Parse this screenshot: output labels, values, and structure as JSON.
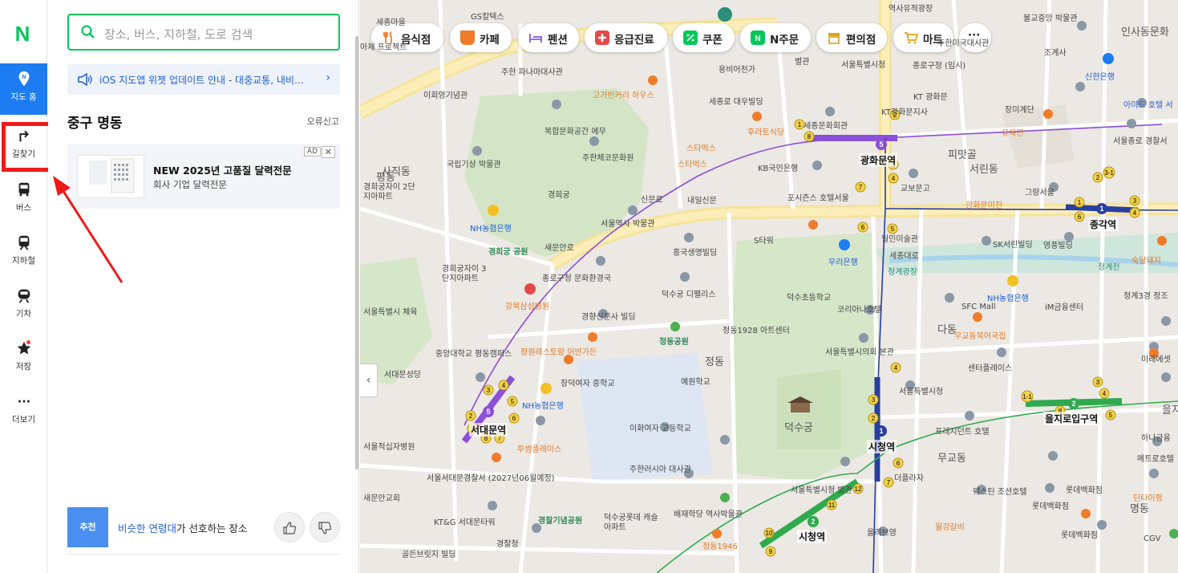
{
  "rail": {
    "logo": "N",
    "items": [
      {
        "label": "지도 홈"
      },
      {
        "label": "길찾기"
      },
      {
        "label": "버스"
      },
      {
        "label": "지하철"
      },
      {
        "label": "기차"
      },
      {
        "label": "저장"
      },
      {
        "label": "더보기"
      }
    ]
  },
  "panel": {
    "search_placeholder": "장소, 버스, 지하철, 도로 검색",
    "notice": "iOS 지도앱 위젯 업데이트 안내 - 대중교통, 내비…",
    "region": "중구 명동",
    "report": "오류신고",
    "ad": {
      "tag": "AD",
      "close": "✕",
      "title": "NEW 2025년 고품질 달력전문",
      "subtitle": "회사 기업 달력전문"
    },
    "recommend": {
      "badge": "추천",
      "highlight": "비슷한 연령대",
      "text": "가 선호하는 장소"
    }
  },
  "map": {
    "categories": [
      {
        "label": "음식점",
        "color": "#f07c2a"
      },
      {
        "label": "카페",
        "color": "#f07c2a"
      },
      {
        "label": "펜션",
        "color": "#8a5ad8"
      },
      {
        "label": "응급진료",
        "color": "#e54848"
      },
      {
        "label": "쿠폰",
        "color": "#03c75a"
      },
      {
        "label": "N주문",
        "color": "#03c75a"
      },
      {
        "label": "편의점",
        "color": "#e2a21b"
      },
      {
        "label": "마트",
        "color": "#e2a21b"
      },
      {
        "label": "···",
        "color": "#444444"
      }
    ],
    "labels": {
      "l01": "주한 파나마대사관",
      "l02": "이회영기념관",
      "l03": "복합문화공간 에무",
      "l04": "주한체코문화원",
      "l05": "국립기상 박물관",
      "l06": "경희궁",
      "l07": "NH농협은행",
      "l08": "서울역사 박물관",
      "l09": "경희궁자이 2단지아파트",
      "l10": "경희궁자이 3단지아파트",
      "l11": "강북삼성병원",
      "l12": "종로구청 문화환경국",
      "l13": "경향신문사 빌딩",
      "l14": "정원레스토랑 어반가든",
      "l15": "중앙대학교 평동캠퍼스",
      "l16": "서대문성당",
      "l17": "창덕여자 중학교",
      "l18": "NH농협은행",
      "l19": "서대문역",
      "l20": "투썸플레이스",
      "l21": "이화여자 고등학교",
      "l22": "주한러시아 대사관",
      "l23": "서울서대문경찰서 (2027년06월예정)",
      "l24": "KT&G 서대문타워",
      "l25": "경찰기념공원",
      "l26": "덕수궁롯데 캐슬아파트",
      "l27": "배재학당 역사박물관",
      "l28": "정동1946",
      "l29": "골든브릿지 빌딩",
      "l30": "경찰청",
      "l31": "용비어천가",
      "l32": "고가빈커리 하우스",
      "l33": "세종로 대우빌딩",
      "l34": "세종문화회관",
      "l35": "후라토식당",
      "l36": "스타벅스",
      "l37": "KB국민은행",
      "l38": "내일신문",
      "l39": "S타워",
      "l40": "흥국생명빌딩",
      "l41": "덕수궁 디팰리스",
      "l42": "포시즌스 호텔서울",
      "l43": "광화문역",
      "l44": "교보문고",
      "l45": "KT광화문지사",
      "l46": "피맛골",
      "l47": "광화문미진",
      "l48": "일민미술관",
      "l49": "우리은행",
      "l50": "청계광장",
      "l51": "덕수초등학교",
      "l52": "코리아나호텔",
      "l53": "정동1928 아트센터",
      "l54": "서울특별시의회 본관",
      "l55": "정동공원",
      "l56": "예원학교",
      "l57": "덕수궁",
      "l58": "시청역",
      "l59": "서울특별시청",
      "l60": "프레지던트 호텔",
      "l61": "서울특별시청 별관",
      "l62": "더플라자",
      "l63": "시청역",
      "l64": "올리브영",
      "l65": "월강갈비",
      "l66": "종각역",
      "l67": "SK서린빌딩",
      "l68": "영풍빌딩",
      "l69": "NH농협은행",
      "l70": "SFC Mall",
      "l71": "iM금융센터",
      "l72": "무교동북어국집",
      "l73": "센터플레이스",
      "l74": "을지로입구역",
      "l75": "롯데백화점",
      "l76": "웨스틴 조선호텔",
      "l77": "롯데백화점",
      "l78": "롯데백화점",
      "l79": "메트로호텔",
      "l80": "인사동문화",
      "l81": "불교중앙 박물관",
      "l82": "조계사",
      "l83": "신한은행",
      "l84": "아미드 호텔 서",
      "l85": "서울종로 경찰서",
      "l86": "장미계단",
      "l87": "유목민",
      "l88": "그랑서울",
      "l89": "숙달돼지",
      "l90": "청계3경 정조",
      "l91": "미래에셋",
      "l92": "하나금융",
      "l93": "딘타이펑",
      "l94": "명동",
      "l95": "CGV",
      "l96": "역사유적광장",
      "l97": "종로구청 (임시)",
      "l98": "서울특별시청",
      "l99": "사직동",
      "l100": "세종마을",
      "l101": "별관",
      "l102": "주한미국대사관",
      "l103": "GS칼텍스",
      "l104": "아제 프로젝트",
      "l105": "서울특별시 체육",
      "l106": "새문안교회",
      "l107": "스타벅스",
      "l108": "경희궁 공원",
      "l109": "서울적십자병원",
      "l110": "KT 광화문",
      "l111": "다동",
      "l112": "서린동",
      "l113": "무교동",
      "l114": "을지로",
      "l115": "청계천",
      "l116": "신문로",
      "l117": "새문안로",
      "l118": "세종대로",
      "l119": "평동",
      "l120": "정동"
    },
    "collapse": "‹"
  }
}
